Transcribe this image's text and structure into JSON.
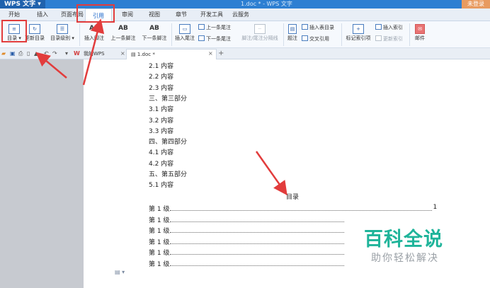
{
  "titlebar": {
    "app_name": "WPS 文字 ▾",
    "doc_title": "1.doc * - WPS 文字",
    "signin": "未登录"
  },
  "menu": {
    "tabs": [
      "开始",
      "插入",
      "页面布局",
      "引用",
      "审阅",
      "视图",
      "章节",
      "开发工具",
      "云服务"
    ],
    "active": "引用"
  },
  "ribbon": {
    "toc": "目录 ▾",
    "update_toc": "更新目录",
    "toc_level": "目录级别 ▾",
    "insert_footnote": "插入脚注",
    "prev_footnote": "上一条脚注",
    "next_footnote": "下一条脚注",
    "insert_endnote": "插入尾注",
    "prev_endnote": "上一条尾注",
    "next_endnote": "下一条尾注",
    "footnote_separator": "脚注/尾注分隔线",
    "caption": "题注",
    "insert_table_of_figures": "插入表目录",
    "cross_reference": "交叉引用",
    "mark_index_entry": "标记索引项",
    "insert_index": "插入索引",
    "update_index": "更新索引",
    "mail": "邮件"
  },
  "doc_tabs": {
    "home": "我的WPS",
    "current": "1.doc *"
  },
  "document": {
    "lines": [
      "2.1 内容",
      "2.2 内容",
      "2.3 内容",
      "三、第三部分",
      "3.1 内容",
      "3.2 内容",
      "3.3 内容",
      "四、第四部分",
      "4.1 内容",
      "4.2 内容",
      "五、第五部分",
      "5.1 内容"
    ],
    "toc_title": "目录",
    "toc_entries": [
      {
        "label": "第 1 级",
        "page": "1"
      },
      {
        "label": "第 1 级",
        "page": ""
      },
      {
        "label": "第 1 级",
        "page": ""
      },
      {
        "label": "第 1 级",
        "page": ""
      },
      {
        "label": "第 1 级",
        "page": ""
      },
      {
        "label": "第 1 级",
        "page": ""
      }
    ]
  },
  "watermark": {
    "title": "百科全说",
    "subtitle": "助你轻松解决"
  },
  "colors": {
    "accent": "#2d7fd2",
    "highlight": "#e23c3c",
    "watermark": "#1fb49a"
  }
}
